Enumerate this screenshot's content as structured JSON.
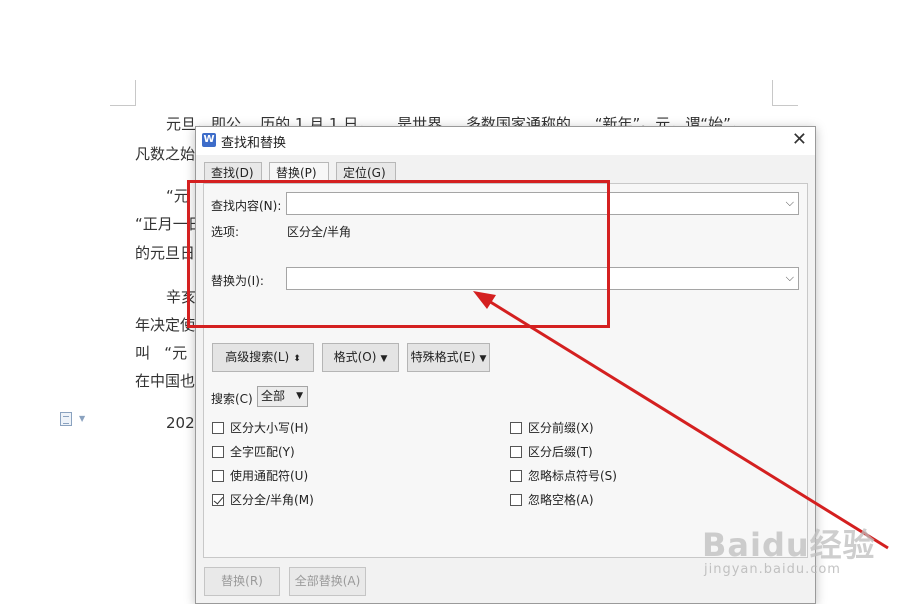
{
  "document": {
    "lines": [
      "元旦，即公    历的 1 月 1 日，     是世界     多数国家通称的     “新年”。元，谓“始”，",
      "凡数之始",
      "“元",
      "“正月一日",
      "的元旦日",
      "辛亥",
      "年决定使",
      "叫   “元",
      "在中国也",
      "202"
    ]
  },
  "dialog": {
    "title": "查找和替换",
    "app_icon": "W",
    "close_label": "✕",
    "tabs": [
      {
        "label": "查找(D)",
        "active": false
      },
      {
        "label": "替换(P)",
        "active": true
      },
      {
        "label": "定位(G)",
        "active": false
      }
    ],
    "find_label": "查找内容(N):",
    "find_value": "",
    "options_label": "选项:",
    "options_value": "区分全/半角",
    "replace_label": "替换为(I):",
    "replace_value": "",
    "buttons": {
      "advanced": "高级搜索(L)",
      "format": "格式(O)",
      "special": "特殊格式(E)",
      "replace": "替换(R)",
      "replace_all": "全部替换(A)"
    },
    "search_label": "搜索(C)",
    "search_value": "全部",
    "checkboxes_left": [
      {
        "label": "区分大小写(H)",
        "checked": false
      },
      {
        "label": "全字匹配(Y)",
        "checked": false
      },
      {
        "label": "使用通配符(U)",
        "checked": false
      },
      {
        "label": "区分全/半角(M)",
        "checked": true
      }
    ],
    "checkboxes_right": [
      {
        "label": "区分前缀(X)",
        "checked": false
      },
      {
        "label": "区分后缀(T)",
        "checked": false
      },
      {
        "label": "忽略标点符号(S)",
        "checked": false
      },
      {
        "label": "忽略空格(A)",
        "checked": false
      }
    ]
  },
  "annotation": {
    "color": "#d42020"
  },
  "watermark": {
    "brand": "Baidu经验",
    "url": "jingyan.baidu.com"
  },
  "icons": {
    "chevron": "⌵",
    "down_arrow": "▼",
    "updown": "⬍",
    "doc_margin": "document-icon"
  }
}
